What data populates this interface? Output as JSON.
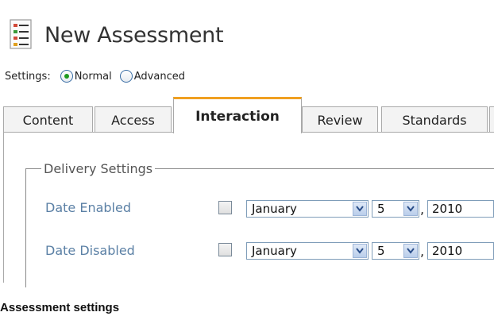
{
  "page": {
    "title": "New Assessment"
  },
  "settings": {
    "label": "Settings:",
    "options": [
      {
        "label": "Normal",
        "checked": true
      },
      {
        "label": "Advanced",
        "checked": false
      }
    ]
  },
  "tabs": [
    {
      "label": "Content",
      "active": false
    },
    {
      "label": "Access",
      "active": false
    },
    {
      "label": "Interaction",
      "active": true
    },
    {
      "label": "Review",
      "active": false
    },
    {
      "label": "Standards",
      "active": false
    }
  ],
  "delivery": {
    "legend": "Delivery Settings",
    "rows": [
      {
        "label": "Date Enabled",
        "checked": false,
        "month": "January",
        "day": "5",
        "year": "2010"
      },
      {
        "label": "Date Disabled",
        "checked": false,
        "month": "January",
        "day": "5",
        "year": "2010"
      }
    ],
    "separator": ","
  },
  "caption": "Assessment settings",
  "colors": {
    "accent_tab": "#f0a020",
    "label_blue": "#5b80a5",
    "radio_dot": "#1f9a1f"
  },
  "icons": {
    "title": "list-document-icon",
    "dropdown": "chevron-down-icon"
  }
}
